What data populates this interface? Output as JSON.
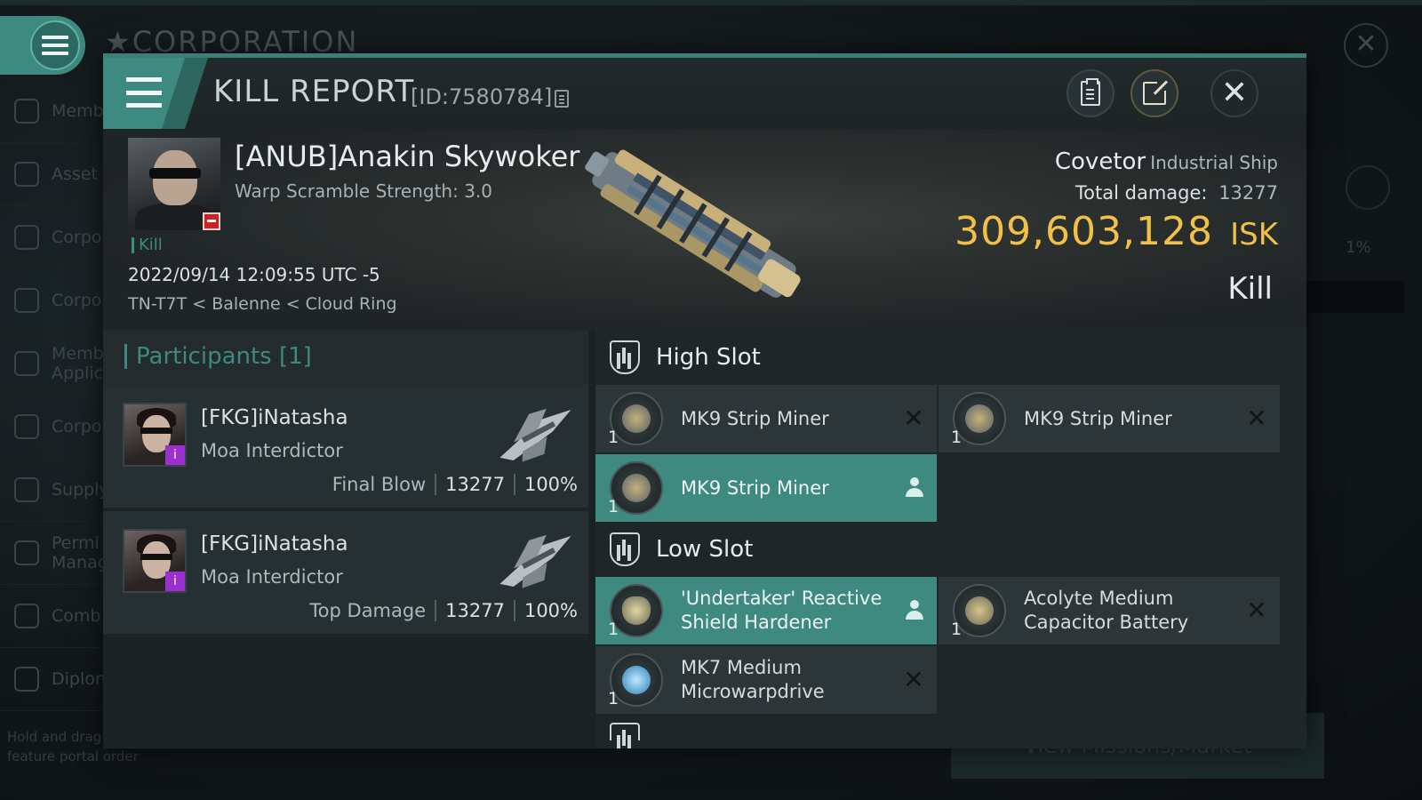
{
  "background": {
    "title": "CORPORATION",
    "sidebar_items": [
      "Memb",
      "Asset",
      "Corpo",
      "Corpo",
      "Memb\nApplic",
      "Corpo",
      "Supply",
      "Permi\nManag",
      "Comb",
      "Diplon"
    ],
    "hint": "Hold and drag feature portal order",
    "right_pct": "1%",
    "right_button": "View Missions/Market"
  },
  "header": {
    "title": "KILL REPORT",
    "report_id": "[ID:7580784]",
    "buttons": {
      "report": "clipboard-icon",
      "share": "external-link-icon",
      "close": "close-icon"
    }
  },
  "victim": {
    "name": "[ANUB]Anakin Skywoker",
    "warp_scramble": "Warp Scramble Strength: 3.0",
    "tag": "Kill",
    "timestamp": "2022/09/14 12:09:55 UTC -5",
    "location": "TN-T7T < Balenne < Cloud Ring",
    "ship_name": "Covetor",
    "ship_class": "Industrial Ship",
    "total_damage_label": "Total damage:",
    "total_damage": "13277",
    "isk_value": "309,603,128",
    "isk_unit": "ISK",
    "result": "Kill"
  },
  "participants": {
    "title": "Participants [1]",
    "rows": [
      {
        "name": "[FKG]iNatasha",
        "ship": "Moa Interdictor",
        "role": "Final Blow",
        "damage": "13277",
        "percent": "100%"
      },
      {
        "name": "[FKG]iNatasha",
        "ship": "Moa Interdictor",
        "role": "Top Damage",
        "damage": "13277",
        "percent": "100%"
      }
    ]
  },
  "fittings": {
    "high_slot": {
      "label": "High Slot",
      "modules": [
        {
          "name": "MK9 Strip Miner",
          "qty": "1",
          "state": "destroyed"
        },
        {
          "name": "MK9 Strip Miner",
          "qty": "1",
          "state": "destroyed"
        },
        {
          "name": "MK9 Strip Miner",
          "qty": "1",
          "state": "dropped"
        }
      ]
    },
    "low_slot": {
      "label": "Low Slot",
      "modules": [
        {
          "name": "'Undertaker' Reactive\nShield Hardener",
          "qty": "1",
          "state": "dropped"
        },
        {
          "name": "Acolyte Medium\nCapacitor Battery",
          "qty": "1",
          "state": "destroyed"
        },
        {
          "name": "MK7 Medium\nMicrowarpdrive",
          "qty": "1",
          "state": "destroyed"
        }
      ]
    }
  },
  "colors": {
    "accent": "#3f8a80",
    "isk": "#f1c047",
    "loss_badge": "#d02020",
    "pilot_badge": "#9b2fd0"
  }
}
